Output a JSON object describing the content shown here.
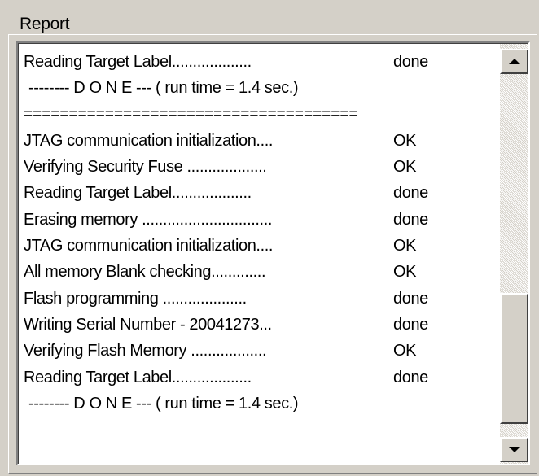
{
  "report": {
    "group_label": "Report",
    "rows": [
      {
        "msg": "Reading Target Label...................",
        "status": "done",
        "kind": "item"
      },
      {
        "msg": "-------- D O N E --- ( run time =   1.4 sec.)",
        "status": "",
        "kind": "summary"
      },
      {
        "msg": "=====================================",
        "status": "",
        "kind": "divider"
      },
      {
        "msg": "JTAG communication initialization....",
        "status": "OK",
        "kind": "item"
      },
      {
        "msg": "Verifying Security Fuse ...................",
        "status": "OK",
        "kind": "item"
      },
      {
        "msg": "Reading Target Label...................",
        "status": "done",
        "kind": "item"
      },
      {
        "msg": "Erasing memory ...............................",
        "status": "done",
        "kind": "item"
      },
      {
        "msg": "JTAG communication initialization....",
        "status": "OK",
        "kind": "item"
      },
      {
        "msg": "All memory Blank checking.............",
        "status": "OK",
        "kind": "item"
      },
      {
        "msg": "Flash programming ....................",
        "status": "done",
        "kind": "item"
      },
      {
        "msg": "Writing Serial Number - 20041273...",
        "status": "done",
        "kind": "item"
      },
      {
        "msg": "Verifying Flash Memory ..................",
        "status": "OK",
        "kind": "item"
      },
      {
        "msg": "Reading Target Label...................",
        "status": "done",
        "kind": "item"
      },
      {
        "msg": "-------- D O N E --- ( run time =   1.4 sec.)",
        "status": "",
        "kind": "summary"
      }
    ]
  },
  "scrollbar": {
    "up_icon": "arrow-up-icon",
    "down_icon": "arrow-down-icon"
  }
}
